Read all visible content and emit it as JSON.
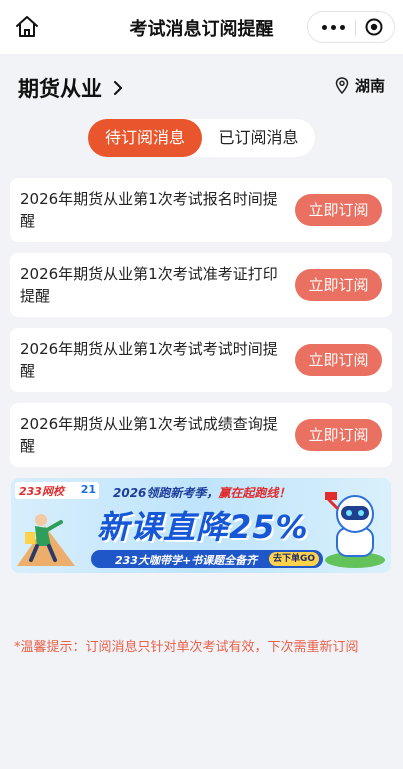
{
  "header": {
    "title": "考试消息订阅提醒"
  },
  "exam": {
    "name": "期货从业",
    "region": "湖南"
  },
  "tabs": [
    {
      "label": "待订阅消息",
      "active": true
    },
    {
      "label": "已订阅消息",
      "active": false
    }
  ],
  "reminders": [
    {
      "text": "2026年期货从业第1次考试报名时间提醒",
      "button": "立即订阅"
    },
    {
      "text": "2026年期货从业第1次考试准考证打印提醒",
      "button": "立即订阅"
    },
    {
      "text": "2026年期货从业第1次考试考试时间提醒",
      "button": "立即订阅"
    },
    {
      "text": "2026年期货从业第1次考试成绩查询提醒",
      "button": "立即订阅"
    }
  ],
  "banner": {
    "logo_text": "233网校",
    "logo_mark": "21",
    "headline_prefix": "2026领跑新考季，",
    "headline_highlight": "赢在起跑线！",
    "big_text": "新课直降25%",
    "pill_text": "233大咖带学+书课题全备齐",
    "cta": "去下单GO"
  },
  "tip": "*温馨提示：订阅消息只针对单次考试有效，下次需重新订阅",
  "colors": {
    "accent": "#e9562d",
    "subscribe_button": "#ea7061",
    "tip_text": "#e8604a",
    "background": "#f2f3f7"
  }
}
